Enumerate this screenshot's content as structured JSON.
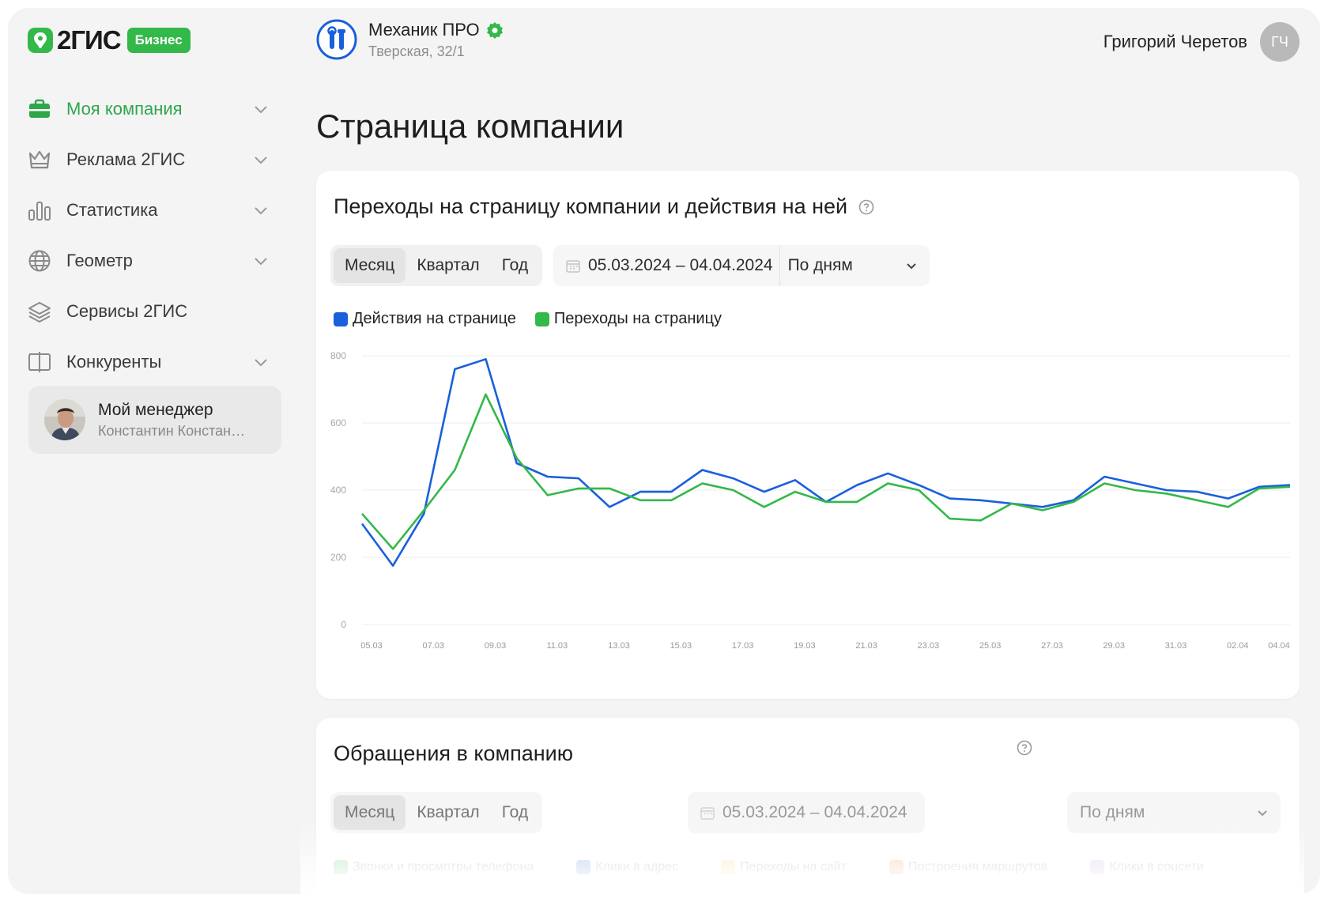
{
  "brand": {
    "name": "2ГИС",
    "badge": "Бизнес",
    "accent": "#2fa64a"
  },
  "sidebar": {
    "items": [
      {
        "label": "Моя компания",
        "icon": "briefcase-icon",
        "active": true,
        "chevron": true
      },
      {
        "label": "Реклама 2ГИС",
        "icon": "crown-icon",
        "active": false,
        "chevron": true
      },
      {
        "label": "Статистика",
        "icon": "bar-chart-icon",
        "active": false,
        "chevron": true
      },
      {
        "label": "Геометр",
        "icon": "globe-icon",
        "active": false,
        "chevron": true
      },
      {
        "label": "Сервисы 2ГИС",
        "icon": "layers-icon",
        "active": false,
        "chevron": false
      },
      {
        "label": "Конкуренты",
        "icon": "compare-icon",
        "active": false,
        "chevron": true
      }
    ],
    "manager": {
      "title": "Мой менеджер",
      "name": "Константин Констан…"
    }
  },
  "header": {
    "company_name": "Механик ПРО",
    "company_address": "Тверская, 32/1",
    "user_name": "Григорий Черетов",
    "user_initials": "ГЧ"
  },
  "page": {
    "title": "Страница компании"
  },
  "card1": {
    "title": "Переходы на страницу компании и действия на ней",
    "tabs": [
      "Месяц",
      "Квартал",
      "Год"
    ],
    "active_tab": 0,
    "date_range": "05.03.2024 – 04.04.2024",
    "period": "По дням"
  },
  "card2": {
    "title": "Обращения в компанию",
    "tabs": [
      "Месяц",
      "Квартал",
      "Год"
    ],
    "active_tab": 0,
    "date_range": "05.03.2024 – 04.04.2024",
    "period": "По дням",
    "legend": [
      {
        "name": "Звонки и просмотры телефона",
        "color": "#33b84a"
      },
      {
        "name": "Клики в адрес",
        "color": "#1a5fdc"
      },
      {
        "name": "Переходы на сайт",
        "color": "#f2d25a"
      },
      {
        "name": "Построения маршрутов",
        "color": "#f07a33"
      },
      {
        "name": "Клики в соцсети",
        "color": "#b38ad6"
      }
    ]
  },
  "chart_data": {
    "type": "line",
    "title": "Переходы на страницу компании и действия на ней",
    "xlabel": "",
    "ylabel": "",
    "ylim": [
      0,
      800
    ],
    "y_ticks": [
      0,
      200,
      400,
      600,
      800
    ],
    "grid": true,
    "legend_position": "top-left",
    "x_tick_labels": [
      "05.03",
      "07.03",
      "09.03",
      "11.03",
      "13.03",
      "15.03",
      "17.03",
      "19.03",
      "21.03",
      "23.03",
      "25.03",
      "27.03",
      "29.03",
      "31.03",
      "02.04",
      "04.04"
    ],
    "x": [
      "05.03",
      "06.03",
      "07.03",
      "08.03",
      "09.03",
      "10.03",
      "11.03",
      "12.03",
      "13.03",
      "14.03",
      "15.03",
      "16.03",
      "17.03",
      "18.03",
      "19.03",
      "20.03",
      "21.03",
      "22.03",
      "23.03",
      "24.03",
      "25.03",
      "26.03",
      "27.03",
      "28.03",
      "29.03",
      "30.03",
      "31.03",
      "01.04",
      "02.04",
      "03.04",
      "04.04"
    ],
    "series": [
      {
        "name": "Действия на странице",
        "color": "#1a5fdc",
        "values": [
          300,
          175,
          330,
          760,
          790,
          480,
          440,
          435,
          350,
          395,
          395,
          460,
          435,
          395,
          430,
          365,
          415,
          450,
          415,
          375,
          370,
          360,
          350,
          370,
          440,
          420,
          400,
          395,
          375,
          410,
          415
        ]
      },
      {
        "name": "Переходы на страницу",
        "color": "#33b84a",
        "values": [
          330,
          225,
          340,
          460,
          685,
          495,
          385,
          405,
          405,
          370,
          370,
          420,
          400,
          350,
          395,
          365,
          365,
          420,
          400,
          315,
          310,
          360,
          340,
          365,
          420,
          400,
          390,
          370,
          350,
          405,
          410
        ]
      }
    ]
  }
}
